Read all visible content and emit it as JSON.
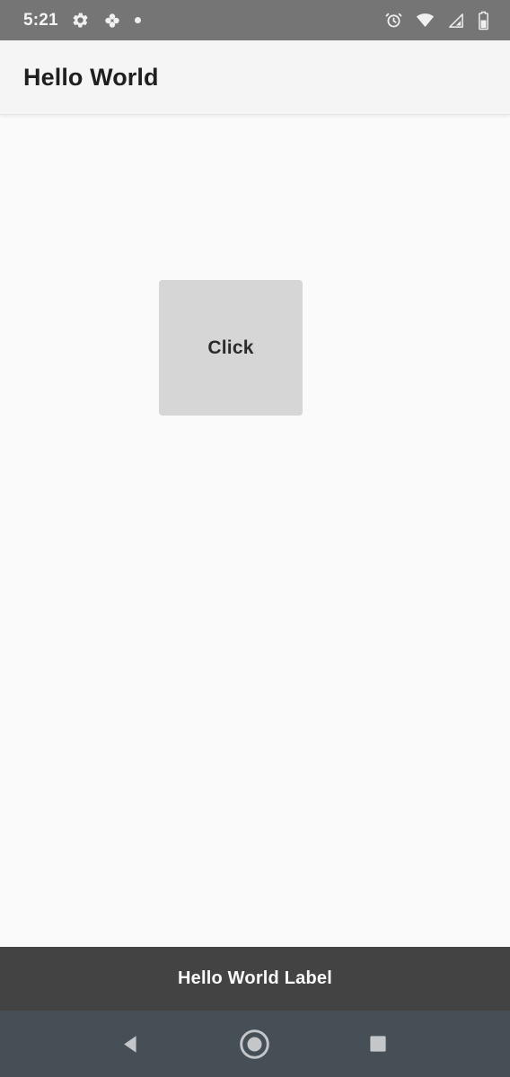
{
  "status_bar": {
    "time": "5:21",
    "background_color": "#757575",
    "left_icons": [
      {
        "name": "gear-icon",
        "label": "Settings"
      },
      {
        "name": "atom-icon",
        "label": "Developer options"
      },
      {
        "name": "dot-icon",
        "label": "Notification dot"
      }
    ],
    "right_icons": [
      {
        "name": "alarm-icon",
        "label": "Alarm set"
      },
      {
        "name": "wifi-icon",
        "label": "Wi-Fi connected"
      },
      {
        "name": "cellular-signal-icon",
        "label": "Mobile signal"
      },
      {
        "name": "battery-icon",
        "label": "Battery"
      }
    ]
  },
  "app_bar": {
    "title": "Hello World",
    "background_color": "#f5f5f5",
    "text_color": "#1f1f1f"
  },
  "content": {
    "background_color": "#fafafa",
    "button": {
      "label": "Click",
      "background_color": "#d6d6d6",
      "text_color": "#2b2b2b"
    }
  },
  "label_bar": {
    "text": "Hello World Label",
    "background_color": "#434343",
    "text_color": "#fbfbfb"
  },
  "nav_bar": {
    "background_color": "#464e56",
    "icon_color": "#c3c7ca",
    "buttons": [
      {
        "name": "back-button",
        "label": "Back"
      },
      {
        "name": "home-button",
        "label": "Home"
      },
      {
        "name": "recents-button",
        "label": "Recent apps"
      }
    ]
  }
}
